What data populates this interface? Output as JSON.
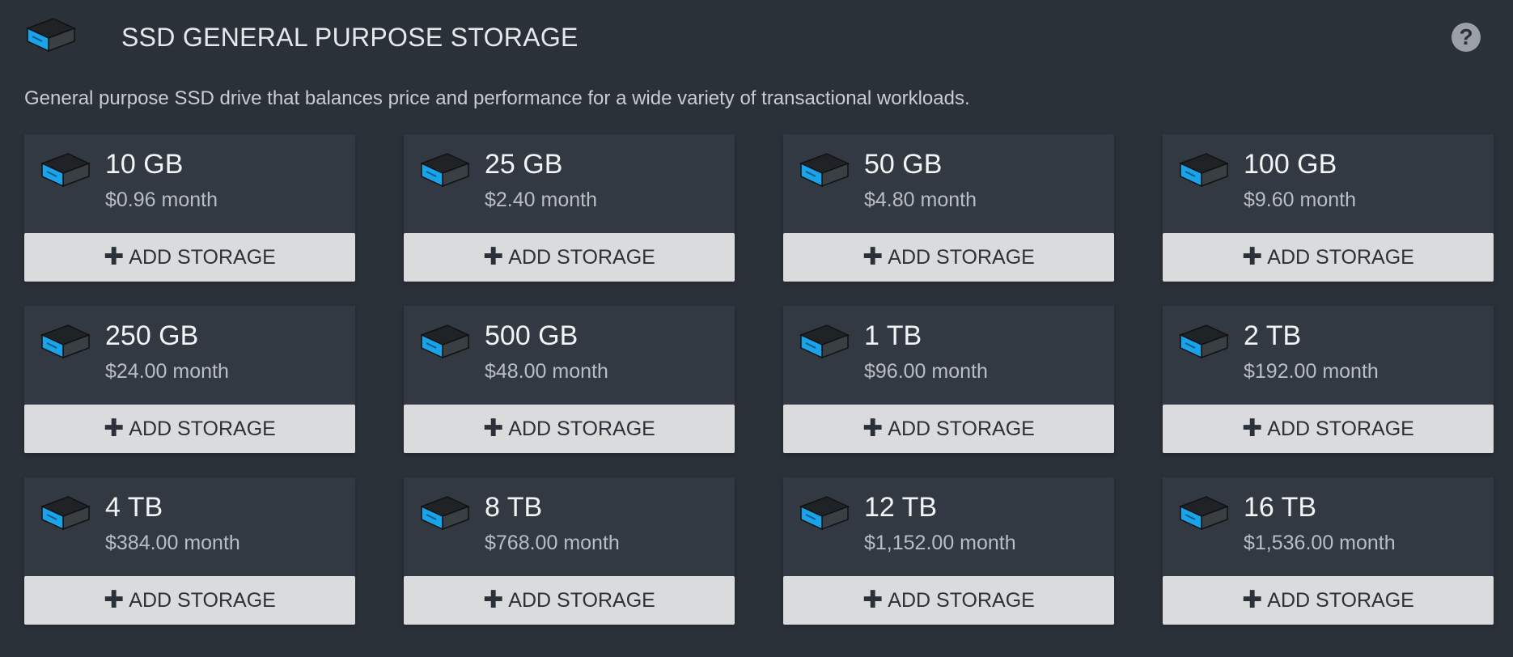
{
  "header": {
    "title": "SSD GENERAL PURPOSE STORAGE",
    "help_label": "?"
  },
  "description": "General purpose SSD drive that balances price and performance for a wide variety of transactional workloads.",
  "colors": {
    "background": "#2b3139",
    "card": "#323942",
    "button": "#d9dbdc",
    "accent": "#1aa3e8"
  },
  "icons": {
    "drive": "storage-drive-icon",
    "plus": "plus-icon",
    "help": "help-icon"
  },
  "plans": [
    {
      "size": "10 GB",
      "price": "$0.96 month",
      "button": "ADD STORAGE"
    },
    {
      "size": "25 GB",
      "price": "$2.40 month",
      "button": "ADD STORAGE"
    },
    {
      "size": "50 GB",
      "price": "$4.80 month",
      "button": "ADD STORAGE"
    },
    {
      "size": "100 GB",
      "price": "$9.60 month",
      "button": "ADD STORAGE"
    },
    {
      "size": "250 GB",
      "price": "$24.00 month",
      "button": "ADD STORAGE"
    },
    {
      "size": "500 GB",
      "price": "$48.00 month",
      "button": "ADD STORAGE"
    },
    {
      "size": "1 TB",
      "price": "$96.00 month",
      "button": "ADD STORAGE"
    },
    {
      "size": "2 TB",
      "price": "$192.00 month",
      "button": "ADD STORAGE"
    },
    {
      "size": "4 TB",
      "price": "$384.00 month",
      "button": "ADD STORAGE"
    },
    {
      "size": "8 TB",
      "price": "$768.00 month",
      "button": "ADD STORAGE"
    },
    {
      "size": "12 TB",
      "price": "$1,152.00 month",
      "button": "ADD STORAGE"
    },
    {
      "size": "16 TB",
      "price": "$1,536.00 month",
      "button": "ADD STORAGE"
    }
  ]
}
